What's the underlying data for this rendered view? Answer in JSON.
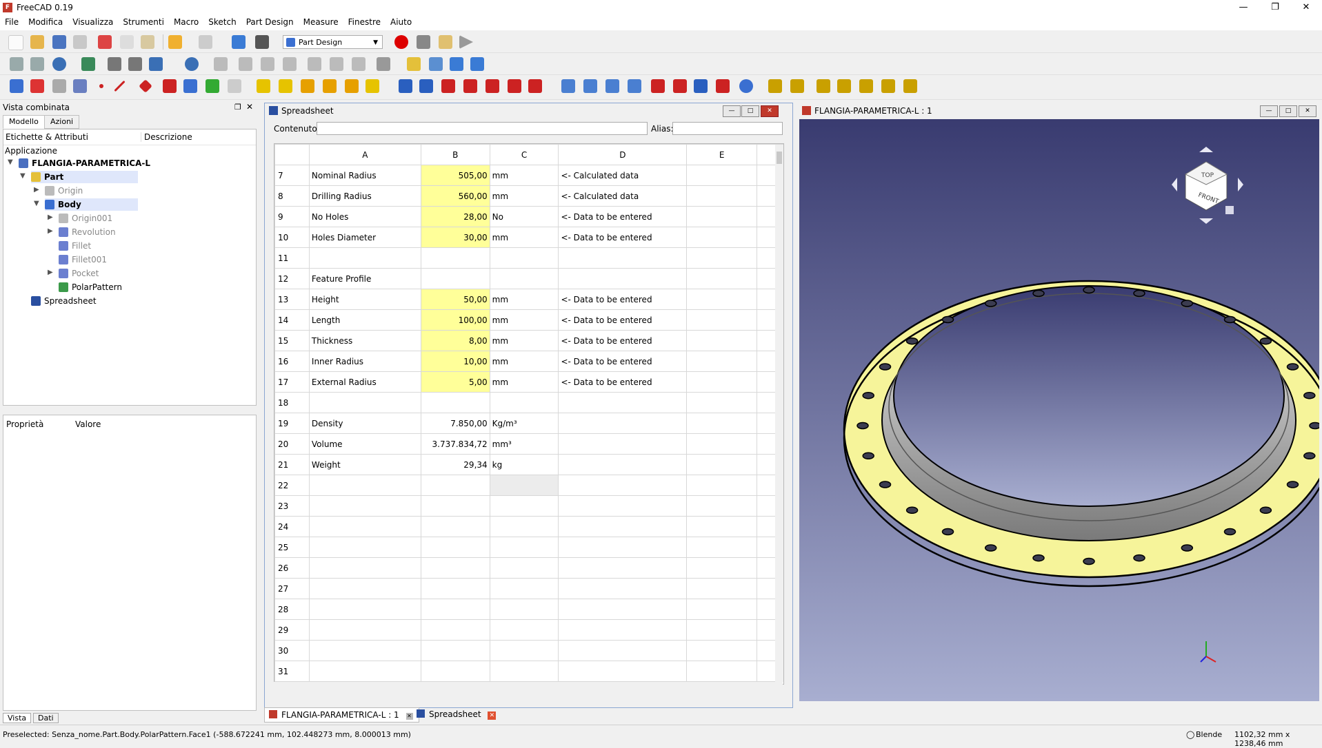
{
  "window": {
    "title": "FreeCAD 0.19"
  },
  "menu": [
    "File",
    "Modifica",
    "Visualizza",
    "Strumenti",
    "Macro",
    "Sketch",
    "Part Design",
    "Measure",
    "Finestre",
    "Aiuto"
  ],
  "workbench": "Part Design",
  "combo": {
    "title": "Vista combinata",
    "tabs": [
      "Modello",
      "Azioni"
    ],
    "tree_headers": [
      "Etichette & Attributi",
      "Descrizione"
    ],
    "section": "Applicazione",
    "tree": [
      {
        "label": "FLANGIA-PARAMETRICA-L",
        "icon": "document-icon",
        "bold": true
      },
      {
        "label": "Part",
        "icon": "part-icon",
        "bold": true
      },
      {
        "label": "Origin",
        "icon": "origin-icon"
      },
      {
        "label": "Body",
        "icon": "body-icon",
        "bold": true
      },
      {
        "label": "Origin001",
        "icon": "origin-icon"
      },
      {
        "label": "Revolution",
        "icon": "revolution-icon"
      },
      {
        "label": "Fillet",
        "icon": "fillet-icon"
      },
      {
        "label": "Fillet001",
        "icon": "fillet-icon"
      },
      {
        "label": "Pocket",
        "icon": "pocket-icon"
      },
      {
        "label": "PolarPattern",
        "icon": "polar-pattern-icon"
      },
      {
        "label": "Spreadsheet",
        "icon": "spreadsheet-icon"
      }
    ],
    "prop_headers": [
      "Proprietà",
      "Valore"
    ],
    "bottom_tabs": [
      "Vista",
      "Dati"
    ]
  },
  "spreadsheet": {
    "title": "Spreadsheet",
    "content_label": "Contenuto:",
    "alias_label": "Alias:",
    "columns": [
      "A",
      "B",
      "C",
      "D",
      "E"
    ],
    "rows": [
      {
        "n": "7",
        "a": "Nominal Radius",
        "b": "505,00",
        "c": "mm",
        "d": "<- Calculated data",
        "hl": true
      },
      {
        "n": "8",
        "a": "Drilling Radius",
        "b": "560,00",
        "c": "mm",
        "d": "<- Calculated data",
        "hl": true
      },
      {
        "n": "9",
        "a": "No Holes",
        "b": "28,00",
        "c": "No",
        "d": "<- Data to be entered",
        "hl": true
      },
      {
        "n": "10",
        "a": "Holes Diameter",
        "b": "30,00",
        "c": "mm",
        "d": "<- Data to be entered",
        "hl": true
      },
      {
        "n": "11",
        "a": "",
        "b": "",
        "c": "",
        "d": ""
      },
      {
        "n": "12",
        "a": "Feature Profile",
        "b": "",
        "c": "",
        "d": ""
      },
      {
        "n": "13",
        "a": "Height",
        "b": "50,00",
        "c": "mm",
        "d": "<- Data to be entered",
        "hl": true
      },
      {
        "n": "14",
        "a": "Length",
        "b": "100,00",
        "c": "mm",
        "d": "<- Data to be entered",
        "hl": true
      },
      {
        "n": "15",
        "a": "Thickness",
        "b": "8,00",
        "c": "mm",
        "d": "<- Data to be entered",
        "hl": true
      },
      {
        "n": "16",
        "a": "Inner Radius",
        "b": "10,00",
        "c": "mm",
        "d": "<- Data to be entered",
        "hl": true
      },
      {
        "n": "17",
        "a": "External Radius",
        "b": "5,00",
        "c": "mm",
        "d": "<- Data to be entered",
        "hl": true
      },
      {
        "n": "18",
        "a": "",
        "b": "",
        "c": "",
        "d": ""
      },
      {
        "n": "19",
        "a": "Density",
        "b": "7.850,00",
        "c": "Kg/m³",
        "d": ""
      },
      {
        "n": "20",
        "a": "Volume",
        "b": "3.737.834,72",
        "c": "mm³",
        "d": ""
      },
      {
        "n": "21",
        "a": "Weight",
        "b": "29,34",
        "c": "kg",
        "d": ""
      },
      {
        "n": "22",
        "a": "",
        "b": "",
        "c": "",
        "d": "",
        "selc": true
      },
      {
        "n": "23",
        "a": "",
        "b": "",
        "c": "",
        "d": ""
      },
      {
        "n": "24",
        "a": "",
        "b": "",
        "c": "",
        "d": ""
      },
      {
        "n": "25",
        "a": "",
        "b": "",
        "c": "",
        "d": ""
      },
      {
        "n": "26",
        "a": "",
        "b": "",
        "c": "",
        "d": ""
      },
      {
        "n": "27",
        "a": "",
        "b": "",
        "c": "",
        "d": ""
      },
      {
        "n": "28",
        "a": "",
        "b": "",
        "c": "",
        "d": ""
      },
      {
        "n": "29",
        "a": "",
        "b": "",
        "c": "",
        "d": ""
      },
      {
        "n": "30",
        "a": "",
        "b": "",
        "c": "",
        "d": ""
      },
      {
        "n": "31",
        "a": "",
        "b": "",
        "c": "",
        "d": ""
      }
    ]
  },
  "view3d": {
    "title": "FLANGIA-PARAMETRICA-L : 1",
    "cube_face": "FRONT",
    "cube_top": "TOP"
  },
  "doc_tabs": [
    "FLANGIA-PARAMETRICA-L : 1",
    "Spreadsheet"
  ],
  "status": {
    "message": "Preselected: Senza_nome.Part.Body.PolarPattern.Face1 (-588.672241 mm, 102.448273 mm, 8.000013 mm)",
    "nav_style": "Blende",
    "dimensions": "1102,32 mm x 1238,46 mm"
  },
  "colors": {
    "cell_yellow": "#ffff99",
    "flange_yellow": "#f6f49a",
    "bg_top": "#393b70",
    "bg_bottom": "#a8aed0"
  }
}
